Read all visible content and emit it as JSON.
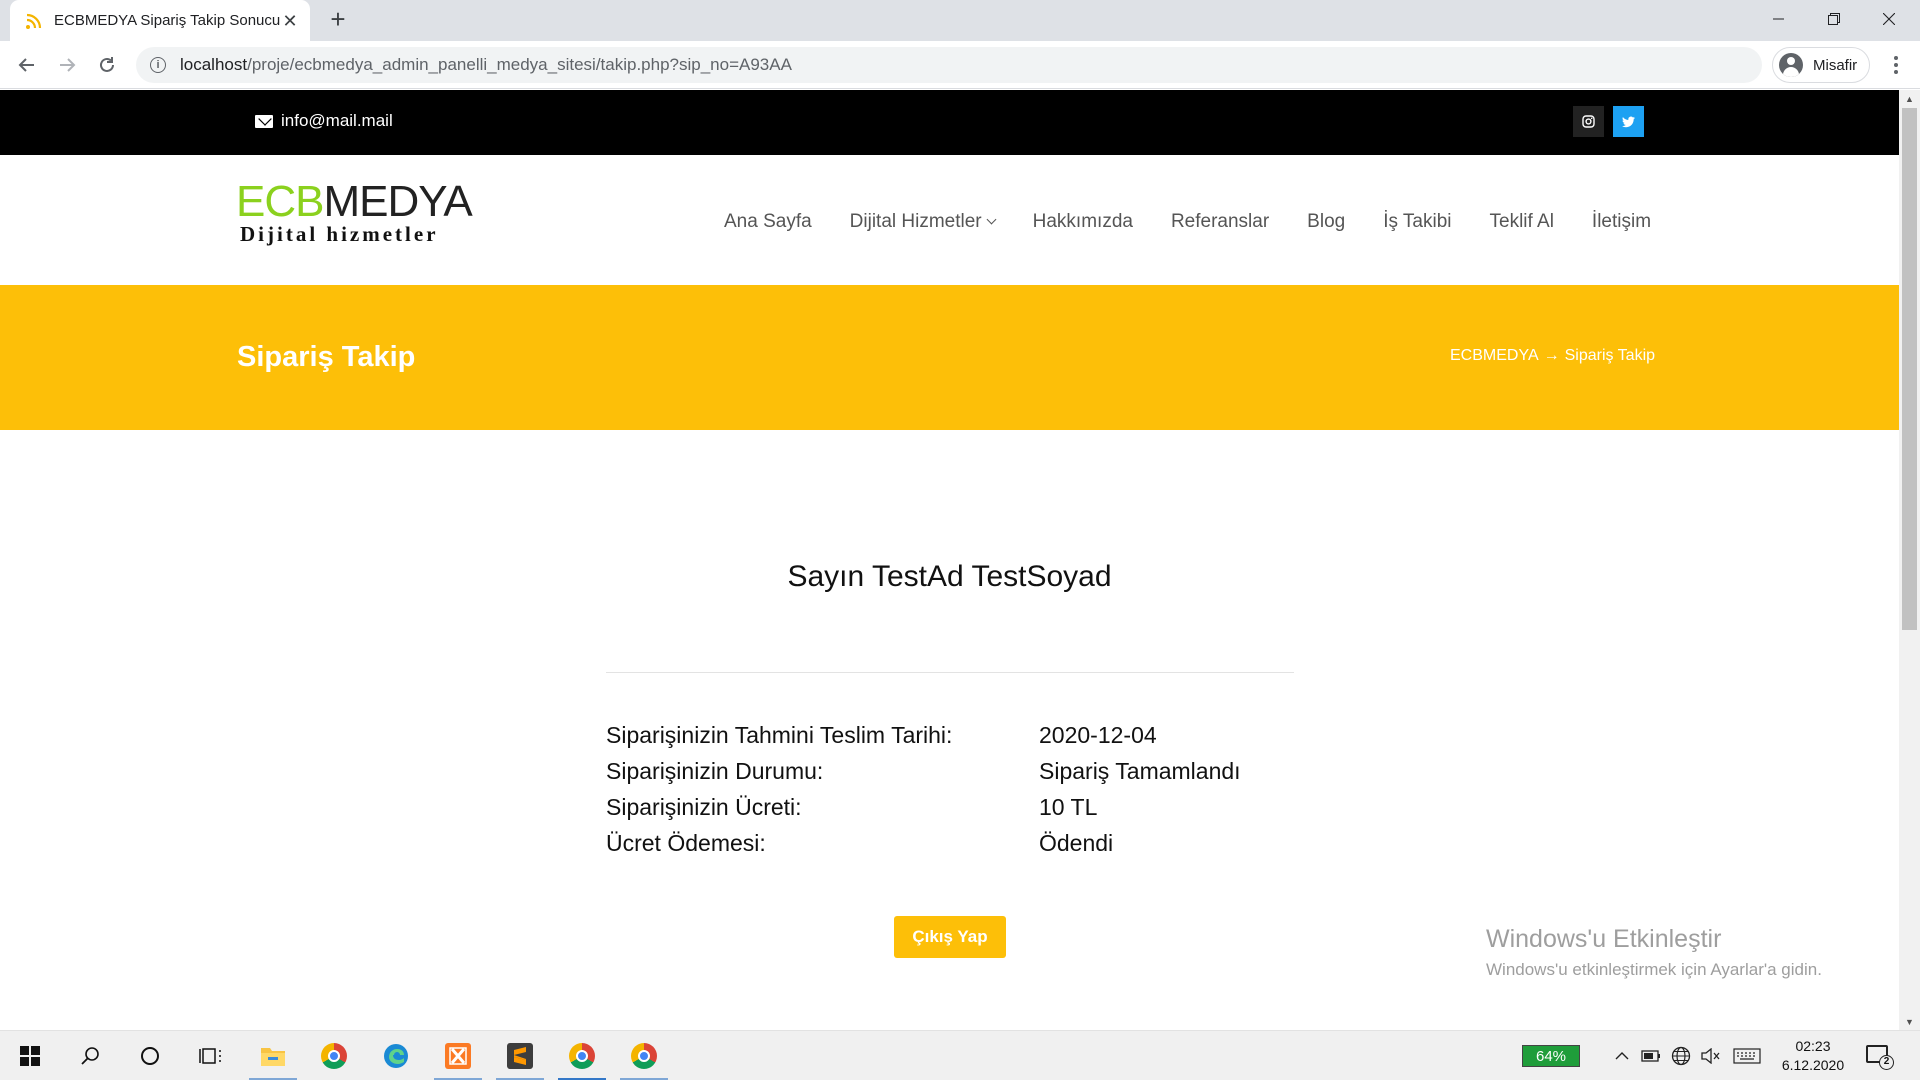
{
  "browser": {
    "tab_title": "ECBMEDYA Sipariş Takip Sonucu",
    "url_host": "localhost",
    "url_path": "/proje/ecbmedya_admin_panelli_medya_sitesi/takip.php?sip_no=A93AA",
    "profile_name": "Misafir"
  },
  "topbar": {
    "email": "info@mail.mail",
    "social": [
      "instagram-icon",
      "twitter-icon"
    ]
  },
  "logo": {
    "ecb": "ECB",
    "medya": "MEDYA",
    "tagline": "Dijital hizmetler"
  },
  "nav": {
    "items": [
      "Ana Sayfa",
      "Dijital Hizmetler",
      "Hakkımızda",
      "Referanslar",
      "Blog",
      "İş Takibi",
      "Teklif Al",
      "İletişim"
    ]
  },
  "banner": {
    "title": "Sipariş Takip",
    "breadcrumb_home": "ECBMEDYA",
    "breadcrumb_arrow": "→",
    "breadcrumb_current": "Sipariş Takip"
  },
  "order": {
    "greeting": "Sayın TestAd TestSoyad",
    "rows": [
      {
        "label": "Siparişinizin Tahmini Teslim Tarihi:",
        "value": "2020-12-04"
      },
      {
        "label": "Siparişinizin Durumu:",
        "value": "Sipariş Tamamlandı"
      },
      {
        "label": "Siparişinizin Ücreti:",
        "value": "10 TL"
      },
      {
        "label": "Ücret Ödemesi:",
        "value": "Ödendi"
      }
    ],
    "logout_label": "Çıkış Yap"
  },
  "watermark": {
    "line1": "Windows'u Etkinleştir",
    "line2": "Windows'u etkinleştirmek için Ayarlar'a gidin."
  },
  "taskbar": {
    "battery": "64%",
    "time": "02:23",
    "date": "6.12.2020",
    "notifications": "2"
  },
  "colors": {
    "accent_yellow": "#fdbf08",
    "logo_green": "#8bd11e",
    "twitter_blue": "#1da1f2"
  }
}
